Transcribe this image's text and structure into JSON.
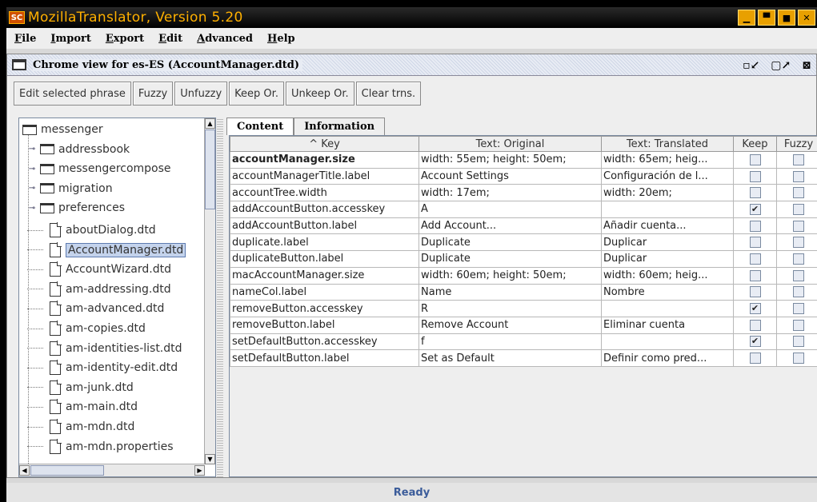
{
  "window": {
    "title": "MozillaTranslator, Version 5.20",
    "icon_name": "app-logo-icon",
    "controls": [
      "minimize-icon",
      "maximize-icon",
      "restore-icon",
      "close-icon"
    ]
  },
  "menubar": {
    "items": [
      {
        "label": "File",
        "underline": "F"
      },
      {
        "label": "Import",
        "underline": "I"
      },
      {
        "label": "Export",
        "underline": "E"
      },
      {
        "label": "Edit",
        "underline": "E"
      },
      {
        "label": "Advanced",
        "underline": "A"
      },
      {
        "label": "Help",
        "underline": "H"
      }
    ]
  },
  "internal_frame": {
    "title": "Chrome view for es-ES (AccountManager.dtd)",
    "controls": [
      "iconify-icon",
      "maximize-icon",
      "close-icon"
    ]
  },
  "toolbar": {
    "buttons": [
      "Edit selected phrase",
      "Fuzzy",
      "Unfuzzy",
      "Keep Or.",
      "Unkeep Or.",
      "Clear trns."
    ]
  },
  "tree": {
    "items": [
      {
        "label": "messenger",
        "type": "folder",
        "level": 0,
        "expandable": false
      },
      {
        "label": "addressbook",
        "type": "folder",
        "level": 1,
        "expandable": true
      },
      {
        "label": "messengercompose",
        "type": "folder",
        "level": 1,
        "expandable": true
      },
      {
        "label": "migration",
        "type": "folder",
        "level": 1,
        "expandable": true
      },
      {
        "label": "preferences",
        "type": "folder",
        "level": 1,
        "expandable": true
      },
      {
        "label": "aboutDialog.dtd",
        "type": "file",
        "level": 1
      },
      {
        "label": "AccountManager.dtd",
        "type": "file",
        "level": 1,
        "selected": true
      },
      {
        "label": "AccountWizard.dtd",
        "type": "file",
        "level": 1
      },
      {
        "label": "am-addressing.dtd",
        "type": "file",
        "level": 1
      },
      {
        "label": "am-advanced.dtd",
        "type": "file",
        "level": 1
      },
      {
        "label": "am-copies.dtd",
        "type": "file",
        "level": 1
      },
      {
        "label": "am-identities-list.dtd",
        "type": "file",
        "level": 1
      },
      {
        "label": "am-identity-edit.dtd",
        "type": "file",
        "level": 1
      },
      {
        "label": "am-junk.dtd",
        "type": "file",
        "level": 1
      },
      {
        "label": "am-main.dtd",
        "type": "file",
        "level": 1
      },
      {
        "label": "am-mdn.dtd",
        "type": "file",
        "level": 1
      },
      {
        "label": "am-mdn.properties",
        "type": "file",
        "level": 1
      }
    ]
  },
  "tabs": [
    {
      "label": "Content",
      "active": true
    },
    {
      "label": "Information",
      "active": false
    }
  ],
  "table": {
    "headers": [
      "^ Key",
      "Text: Original",
      "Text: Translated",
      "Keep",
      "Fuzzy"
    ],
    "rows": [
      {
        "key": "accountManager.size",
        "original": "width: 55em; height: 50em;",
        "translated": "width: 65em; heig...",
        "keep": false,
        "fuzzy": false,
        "bold": true
      },
      {
        "key": "accountManagerTitle.label",
        "original": "Account Settings",
        "translated": "Configuración de l...",
        "keep": false,
        "fuzzy": false
      },
      {
        "key": "accountTree.width",
        "original": "width: 17em;",
        "translated": "width: 20em;",
        "keep": false,
        "fuzzy": false
      },
      {
        "key": "addAccountButton.accesskey",
        "original": "A",
        "translated": "",
        "keep": true,
        "fuzzy": false
      },
      {
        "key": "addAccountButton.label",
        "original": "Add Account...",
        "translated": "Añadir cuenta...",
        "keep": false,
        "fuzzy": false
      },
      {
        "key": "duplicate.label",
        "original": "Duplicate",
        "translated": "Duplicar",
        "keep": false,
        "fuzzy": false
      },
      {
        "key": "duplicateButton.label",
        "original": "Duplicate",
        "translated": "Duplicar",
        "keep": false,
        "fuzzy": false
      },
      {
        "key": "macAccountManager.size",
        "original": "width: 60em; height: 50em;",
        "translated": "width: 60em; heig...",
        "keep": false,
        "fuzzy": false
      },
      {
        "key": "nameCol.label",
        "original": "Name",
        "translated": "Nombre",
        "keep": false,
        "fuzzy": false
      },
      {
        "key": "removeButton.accesskey",
        "original": "R",
        "translated": "",
        "keep": true,
        "fuzzy": false
      },
      {
        "key": "removeButton.label",
        "original": "Remove Account",
        "translated": "Eliminar cuenta",
        "keep": false,
        "fuzzy": false
      },
      {
        "key": "setDefaultButton.accesskey",
        "original": "f",
        "translated": "",
        "keep": true,
        "fuzzy": false
      },
      {
        "key": "setDefaultButton.label",
        "original": "Set as Default",
        "translated": "Definir como pred...",
        "keep": false,
        "fuzzy": false
      }
    ]
  },
  "status": {
    "text": "Ready"
  },
  "colors": {
    "title_fg": "#ffb000",
    "selection_bg": "#c4d3ec",
    "status_fg": "#3b5c9a"
  }
}
